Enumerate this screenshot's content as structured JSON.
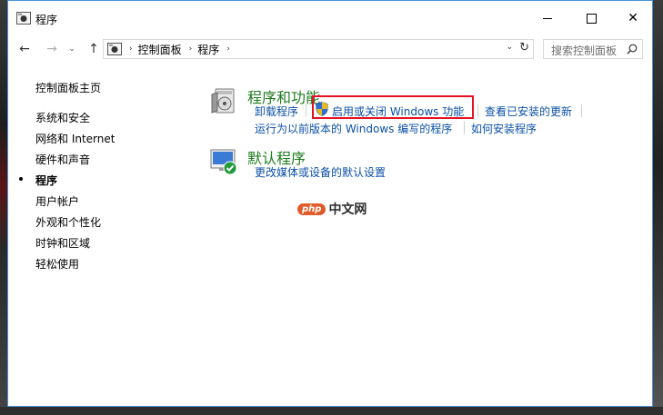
{
  "window": {
    "title": "程序",
    "controls": {
      "minimize": "minimize",
      "maximize": "maximize",
      "close": "✕"
    }
  },
  "nav": {
    "back_icon": "←",
    "forward_icon": "→",
    "recent_icon": "⌄",
    "up_icon": "↑",
    "breadcrumb": [
      "控制面板",
      "程序"
    ],
    "breadcrumb_sep": "›",
    "dropdown_icon": "⌄",
    "refresh_icon": "↻",
    "search_placeholder": "搜索控制面板"
  },
  "sidebar": {
    "items": [
      {
        "label": "控制面板主页",
        "current": false
      },
      {
        "label": "系统和安全",
        "current": false
      },
      {
        "label": "网络和 Internet",
        "current": false
      },
      {
        "label": "硬件和声音",
        "current": false
      },
      {
        "label": "程序",
        "current": true
      },
      {
        "label": "用户帐户",
        "current": false
      },
      {
        "label": "外观和个性化",
        "current": false
      },
      {
        "label": "时钟和区域",
        "current": false
      },
      {
        "label": "轻松使用",
        "current": false
      }
    ]
  },
  "sections": {
    "programs": {
      "title": "程序和功能",
      "icon": "programs-features-icon",
      "links": {
        "uninstall": "卸载程序",
        "windows_features": "启用或关闭 Windows 功能",
        "view_updates": "查看已安装的更新",
        "run_older": "运行为以前版本的 Windows 编写的程序",
        "how_install": "如何安装程序"
      }
    },
    "defaults": {
      "title": "默认程序",
      "icon": "default-programs-icon",
      "links": {
        "change_defaults": "更改媒体或设备的默认设置"
      }
    }
  },
  "watermark": {
    "badge": "php",
    "text": "中文网"
  },
  "colors": {
    "link": "#0a4fa6",
    "section_title": "#1e7b1e",
    "highlight": "#e81123",
    "window_border": "#4a90d9"
  }
}
